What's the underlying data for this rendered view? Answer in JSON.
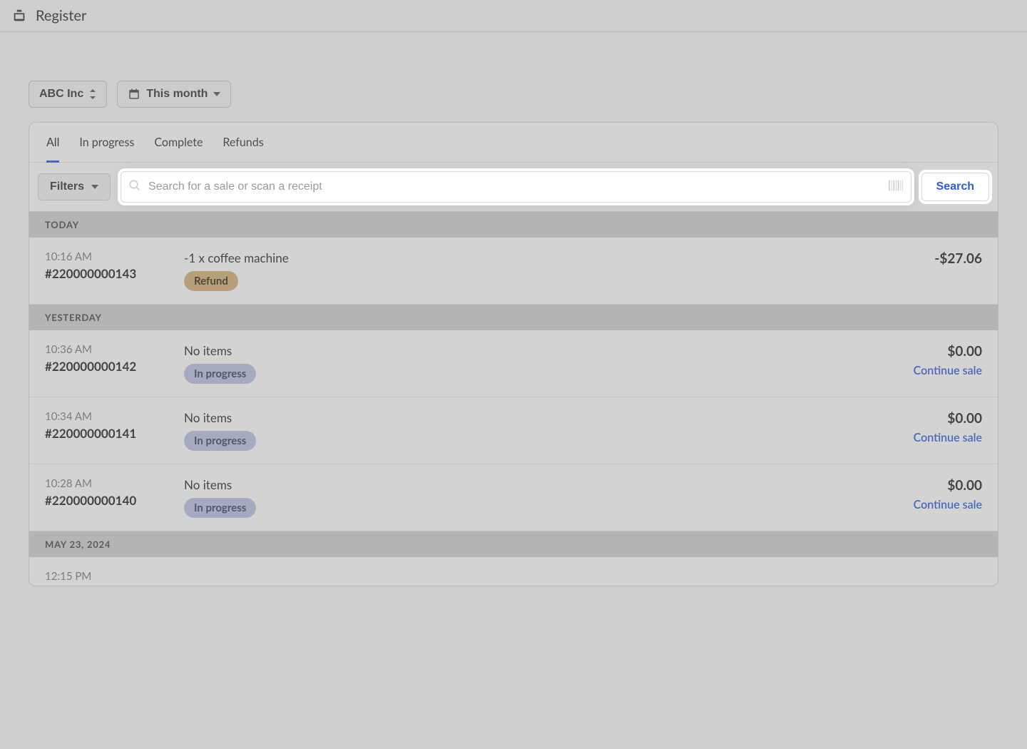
{
  "header": {
    "title": "Register"
  },
  "toolbar": {
    "company_label": "ABC Inc",
    "period_label": "This month"
  },
  "tabs": [
    {
      "label": "All",
      "active": true
    },
    {
      "label": "In progress",
      "active": false
    },
    {
      "label": "Complete",
      "active": false
    },
    {
      "label": "Refunds",
      "active": false
    }
  ],
  "filters_label": "Filters",
  "search": {
    "placeholder": "Search for a sale or scan a receipt",
    "button_label": "Search"
  },
  "continue_label": "Continue sale",
  "badges": {
    "refund": "Refund",
    "in_progress": "In progress"
  },
  "groups": [
    {
      "label": "TODAY",
      "rows": [
        {
          "time": "10:16 AM",
          "order": "#220000000143",
          "items": "-1 x coffee machine",
          "status": "refund",
          "amount": "-$27.06",
          "continue": false
        }
      ]
    },
    {
      "label": "YESTERDAY",
      "rows": [
        {
          "time": "10:36 AM",
          "order": "#220000000142",
          "items": "No items",
          "status": "in_progress",
          "amount": "$0.00",
          "continue": true
        },
        {
          "time": "10:34 AM",
          "order": "#220000000141",
          "items": "No items",
          "status": "in_progress",
          "amount": "$0.00",
          "continue": true
        },
        {
          "time": "10:28 AM",
          "order": "#220000000140",
          "items": "No items",
          "status": "in_progress",
          "amount": "$0.00",
          "continue": true
        }
      ]
    },
    {
      "label": "MAY 23, 2024",
      "rows": [
        {
          "time": "12:15 PM",
          "order": "",
          "items": "",
          "status": "",
          "amount": "",
          "continue": false
        }
      ]
    }
  ]
}
